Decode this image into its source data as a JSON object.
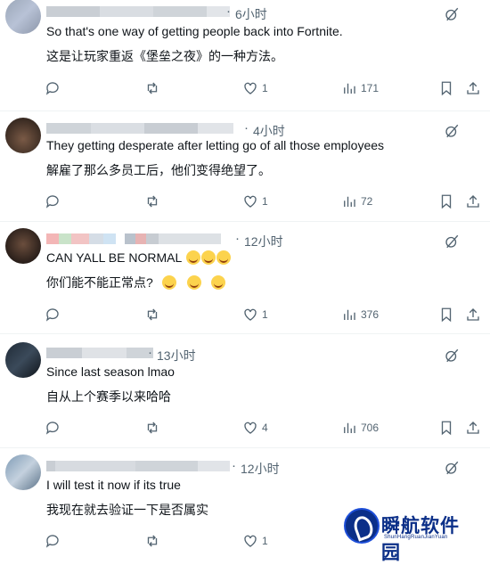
{
  "replies": [
    {
      "time": "6小时",
      "lines": [
        "So that's one way of getting people back into Fortnite.",
        "这是让玩家重返《堡垒之夜》的一种方法。"
      ],
      "likes": "1",
      "views": "171"
    },
    {
      "time": "4小时",
      "lines": [
        "They getting desperate after letting go of all those employees",
        "解雇了那么多员工后，他们变得绝望了。"
      ],
      "likes": "1",
      "views": "72"
    },
    {
      "time": "12小时",
      "lines": [
        "CAN YALL BE NORMAL",
        "你们能不能正常点?"
      ],
      "likes": "1",
      "views": "376"
    },
    {
      "time": "13小时",
      "lines": [
        "Since last season lmao",
        "自从上个赛季以来哈哈"
      ],
      "likes": "4",
      "views": "706"
    },
    {
      "time": "12小时",
      "lines": [
        "I will test it now if its true",
        "我现在就去验证一下是否属实"
      ],
      "likes": "1",
      "views": ""
    }
  ],
  "watermark": {
    "title": "瞬航软件园",
    "subtitle": "ShunHangRuanJianYuan"
  },
  "icons": {
    "reply": "reply-icon",
    "repost": "repost-icon",
    "like": "heart-icon",
    "views": "views-icon",
    "bookmark": "bookmark-icon",
    "grok": "grok-icon"
  },
  "colors": {
    "muted": "#536471",
    "text": "#0f1419",
    "divider": "#eff3f4",
    "watermark": "#0b2f88"
  }
}
